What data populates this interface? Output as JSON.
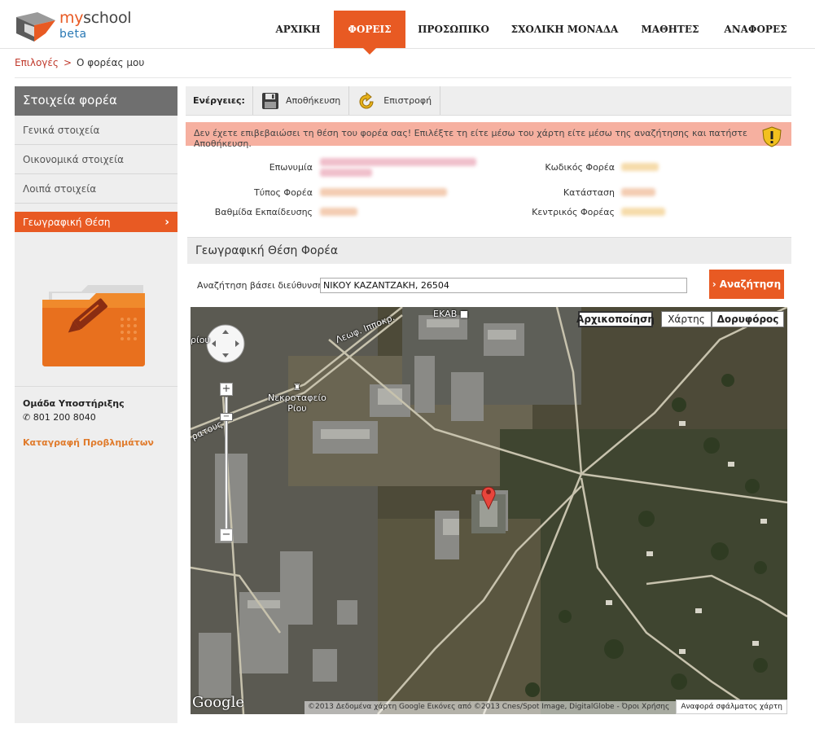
{
  "logo": {
    "my": "my",
    "school": "school",
    "beta": "beta"
  },
  "nav": {
    "items": [
      "ΑΡΧΙΚΗ",
      "ΦΟΡΕΙΣ",
      "ΠΡΟΣΩΠΙΚΟ",
      "ΣΧΟΛΙΚΗ ΜΟΝΑΔΑ",
      "ΜΑΘΗΤΕΣ",
      "ΑΝΑΦΟΡΕΣ"
    ],
    "active": "ΦΟΡΕΙΣ"
  },
  "breadcrumb": {
    "root": "Επιλογές",
    "separator": ">",
    "current": "Ο φορέας μου"
  },
  "sidebar": {
    "title": "Στοιχεία φορέα",
    "items": [
      "Γενικά στοιχεία",
      "Οικονομικά στοιχεία",
      "Λοιπά στοιχεία",
      "Γεωγραφική Θέση"
    ],
    "support_title": "Ομάδα Υποστήριξης",
    "support_phone": "801 200 8040",
    "support_link": "Καταγραφή Προβλημάτων"
  },
  "toolbar": {
    "label": "Ενέργειες:",
    "save": "Αποθήκευση",
    "back": "Επιστροφή"
  },
  "warning": "Δεν έχετε επιβεβαιώσει τη θέση του φορέα σας! Επιλέξτε τη είτε μέσω του χάρτη είτε μέσω της αναζήτησης και πατήστε Αποθήκευση.",
  "fields": {
    "name": "Επωνυμία",
    "type": "Τύπος Φορέα",
    "level": "Βαθμίδα Εκπαίδευσης",
    "code": "Κωδικός Φορέα",
    "status": "Κατάσταση",
    "central": "Κεντρικός Φορέας"
  },
  "section": {
    "title": "Γεωγραφική Θέση Φορέα"
  },
  "search": {
    "label": "Αναζήτηση βάσει διεύθυνσης",
    "value": "ΝΙΚΟΥ ΚΑΖΑΝΤΖΑΚΗ, 26504",
    "button": "Αναζήτηση"
  },
  "map": {
    "reset": "Αρχικοποίηση",
    "map_type": "Χάρτης",
    "satellite": "Δορυφόρος",
    "google": "Google",
    "attribution": "©2013 Δεδομένα χάρτη Google Εικόνες από ©2013 Cnes/Spot Image, DigitalGlobe - Όροι Χρήσης",
    "report": "Αναφορά σφάλματος χάρτη",
    "label_ekav": "ΕΚΑΒ",
    "label_cemetery1": "Νεκροταφείο",
    "label_cemetery2": "Ρίου",
    "label_road": "Λεωφ. Ιπποκρ.",
    "label_rio": "ρίου",
    "label_dias": "ρατους"
  },
  "colors": {
    "accent": "#e85a23",
    "warning": "#f6b0a0"
  }
}
